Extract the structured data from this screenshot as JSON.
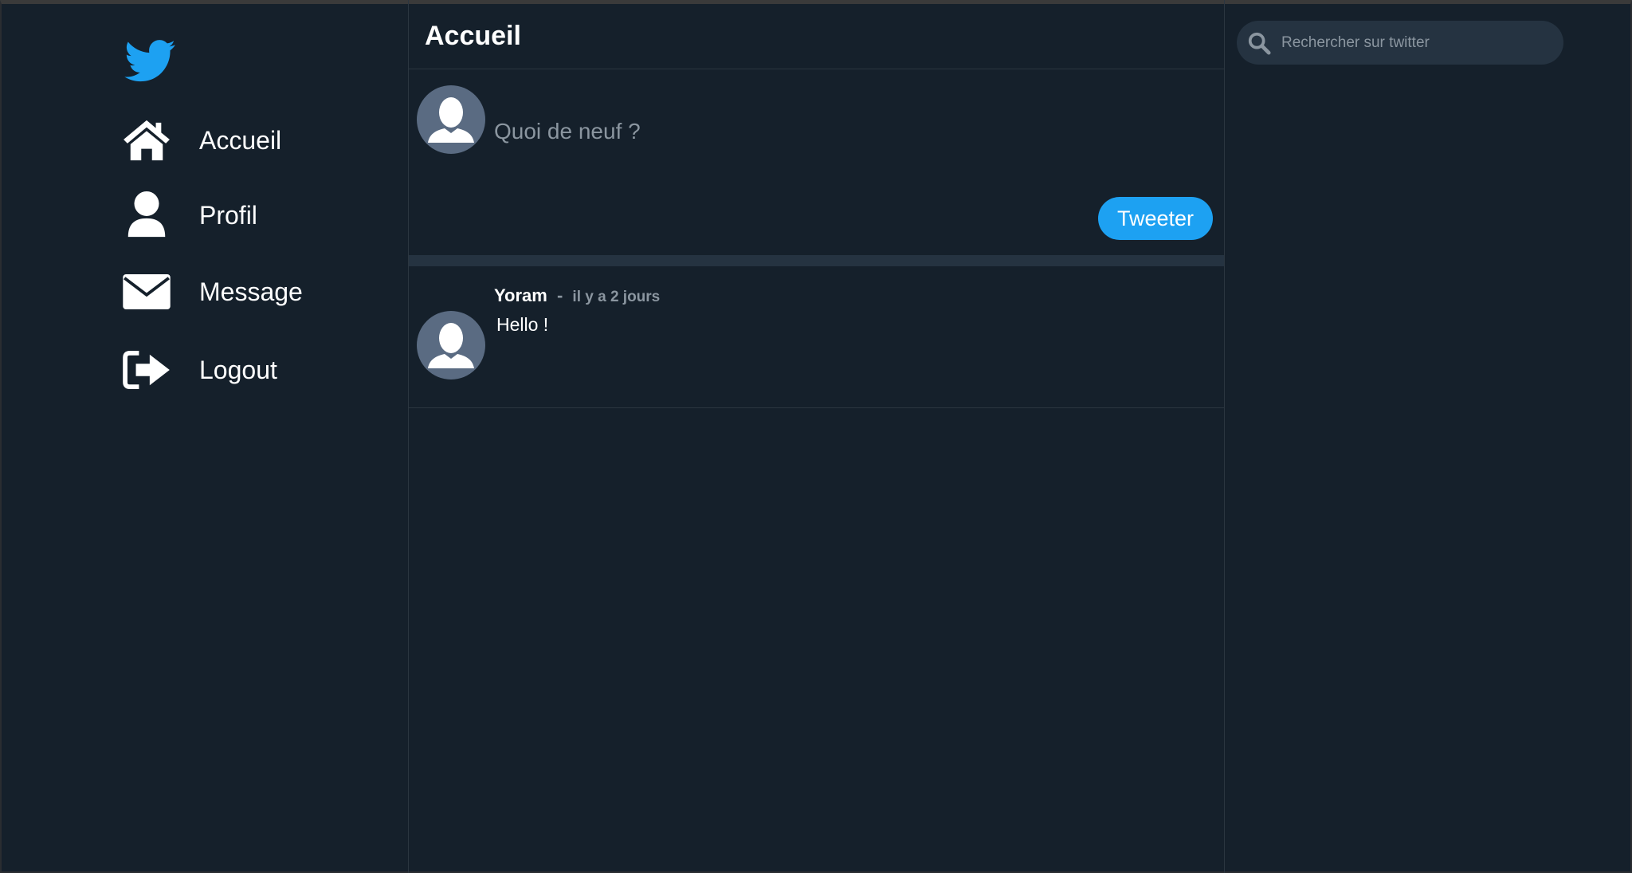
{
  "brand": {
    "logo_icon": "twitter-bird-icon",
    "color": "#1da1f2"
  },
  "sidebar": {
    "items": [
      {
        "label": "Accueil",
        "icon": "home-icon"
      },
      {
        "label": "Profil",
        "icon": "user-icon"
      },
      {
        "label": "Message",
        "icon": "envelope-icon"
      },
      {
        "label": "Logout",
        "icon": "logout-icon"
      }
    ]
  },
  "main": {
    "title": "Accueil",
    "composer": {
      "placeholder": "Quoi de neuf ?",
      "value": "",
      "button_label": "Tweeter"
    },
    "tweets": [
      {
        "author": "Yoram",
        "separator": "-",
        "time": "il y a 2 jours",
        "text": "Hello !"
      }
    ]
  },
  "search": {
    "placeholder": "Rechercher sur twitter",
    "value": ""
  },
  "colors": {
    "background": "#15202b",
    "surface": "#253341",
    "accent": "#1da1f2",
    "muted_text": "#8b96a0",
    "avatar": "#5a6b82"
  }
}
